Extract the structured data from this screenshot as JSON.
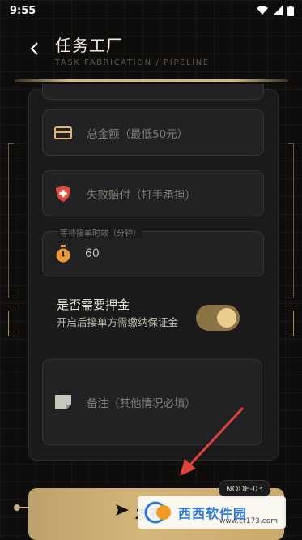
{
  "status_bar": {
    "time": "9:55"
  },
  "header": {
    "title": "任务工厂",
    "subtitle": "TASK FABRICATION / PIPELINE"
  },
  "form": {
    "total_amount_placeholder": "总金额（最低50元）",
    "failure_comp_placeholder": "失败赔付（打手承担）",
    "wait_time_label": "等待接单时效（分钟）",
    "wait_time_value": "60",
    "deposit_title": "是否需要押金",
    "deposit_desc": "开启后接单方需缴纳保证金",
    "deposit_enabled": true,
    "notes_placeholder": "备注（其他情况必填）"
  },
  "submit": {
    "label": "发布"
  },
  "node_tag": "NODE-03",
  "watermark": {
    "text": "西西软件园",
    "url": "www.cr173.com"
  },
  "colors": {
    "accent": "#d8b878",
    "card": "#1a1a1b",
    "field": "#222224",
    "danger": "#e04a3f"
  }
}
